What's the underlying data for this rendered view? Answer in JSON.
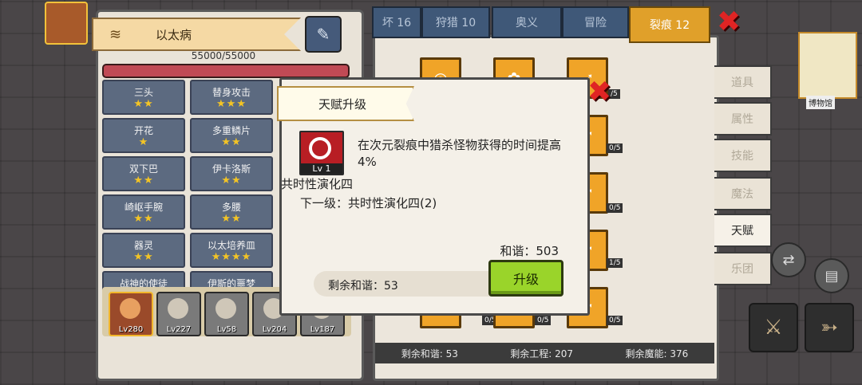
{
  "character": {
    "name": "以太病",
    "hp_text": "55000/55000"
  },
  "skills": [
    {
      "name": "三头",
      "stars": "★★"
    },
    {
      "name": "替身攻击",
      "stars": "★★★"
    },
    {
      "name": "开花",
      "stars": "★"
    },
    {
      "name": "多重鳞片",
      "stars": "★★"
    },
    {
      "name": "双下巴",
      "stars": "★★"
    },
    {
      "name": "伊卡洛斯",
      "stars": "★★"
    },
    {
      "name": "崎岖手腕",
      "stars": "★★"
    },
    {
      "name": "多腰",
      "stars": "★★"
    },
    {
      "name": "器灵",
      "stars": "★★"
    },
    {
      "name": "以太培养皿",
      "stars": "★★★★"
    },
    {
      "name": "战神的使徒",
      "stars": "★"
    },
    {
      "name": "伊斯的噩梦",
      "stars": "★★"
    }
  ],
  "heroes": [
    {
      "level": "Lv280",
      "selected": true
    },
    {
      "level": "Lv227",
      "selected": false
    },
    {
      "level": "Lv58",
      "selected": false
    },
    {
      "level": "Lv204",
      "selected": false
    },
    {
      "level": "Lv187",
      "selected": false
    }
  ],
  "tabs": [
    {
      "label": "坏 16"
    },
    {
      "label": "狩猎 10"
    },
    {
      "label": "奥义"
    },
    {
      "label": "冒险"
    },
    {
      "label": "裂痕 12",
      "active": true
    }
  ],
  "side_tabs": [
    "道具",
    "属性",
    "技能",
    "魔法",
    "天赋",
    "乐团"
  ],
  "side_tab_active": "天赋",
  "node_counts": [
    "/5",
    "0/5",
    "0/5",
    "0/5",
    "1/5",
    "0/5",
    "0/5",
    "0/5"
  ],
  "footer": {
    "remaining_harmony": "剩余和谐: 53",
    "remaining_engineering": "剩余工程: 207",
    "remaining_magic": "剩余魔能: 376"
  },
  "modal": {
    "title": "天赋升级",
    "icon_level": "Lv 1",
    "description": "在次元裂痕中猎杀怪物获得的时间提高4%",
    "talent_name": "共时性演化四",
    "next_level": "下一级：共时性演化四(2)",
    "cost": "和谐：503",
    "remaining": "剩余和谐：53",
    "upgrade_label": "升级"
  },
  "hud": {
    "map_label": "博物馆",
    "icons": [
      "gear-icon",
      "swap-icon",
      "book-icon",
      "sword-icon",
      "bow-icon"
    ]
  },
  "colors": {
    "accent_orange": "#f0a428",
    "upgrade_green": "#9ad42a",
    "close_red": "#e02424",
    "hp_red": "#c04a55"
  }
}
